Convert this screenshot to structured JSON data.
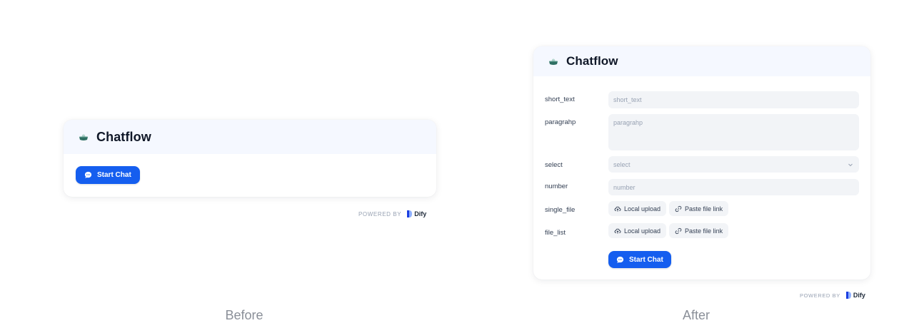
{
  "before": {
    "app_title": "Chatflow",
    "start_chat_label": "Start Chat",
    "powered_by": "POWERED BY",
    "brand": "Dify",
    "caption": "Before"
  },
  "after": {
    "app_title": "Chatflow",
    "fields": [
      {
        "label": "short_text",
        "placeholder": "short_text",
        "type": "text"
      },
      {
        "label": "paragrahp",
        "placeholder": "paragrahp",
        "type": "paragraph"
      },
      {
        "label": "select",
        "placeholder": "select",
        "type": "select"
      },
      {
        "label": "number",
        "placeholder": "number",
        "type": "number"
      },
      {
        "label": "single_file",
        "type": "file"
      },
      {
        "label": "file_list",
        "type": "file"
      }
    ],
    "local_upload_label": "Local upload",
    "paste_link_label": "Paste file link",
    "start_chat_label": "Start Chat",
    "powered_by": "POWERED BY",
    "brand": "Dify",
    "caption": "After"
  },
  "colors": {
    "primary": "#155eef",
    "header_bg": "#f5f8ff",
    "field_bg": "#f2f4f7"
  },
  "icons": {
    "app": "cake-bowl-icon",
    "chat": "chat-bubble-icon",
    "upload": "cloud-upload-icon",
    "link": "link-icon",
    "chevron": "chevron-down-icon",
    "brand": "dify-logo-icon"
  }
}
